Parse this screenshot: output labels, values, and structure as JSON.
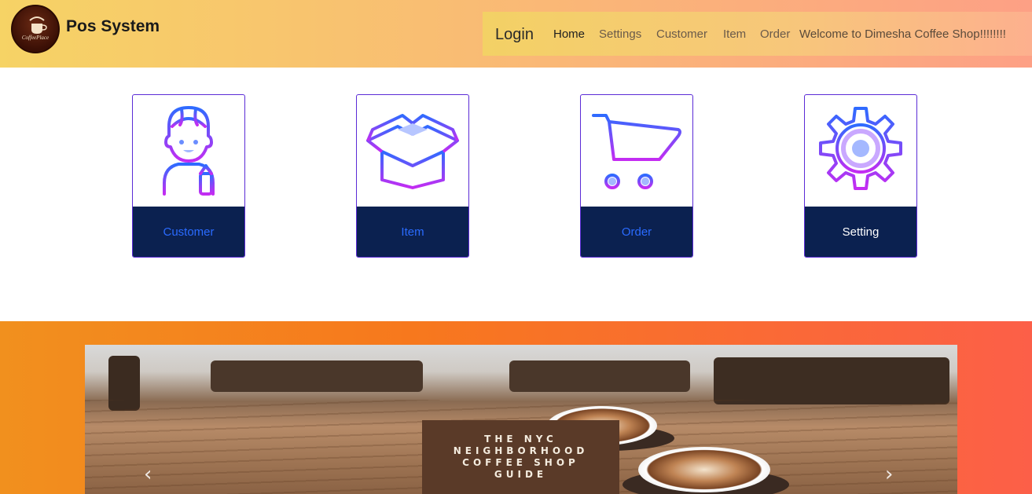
{
  "header": {
    "brand": "Pos System",
    "logo_text": "CoffeePlace",
    "nav": {
      "login": "Login",
      "links": [
        "Home",
        "Settings",
        "Customer",
        "Item",
        "Order"
      ],
      "welcome": "Welcome to Dimesha Coffee Shop!!!!!!!!"
    }
  },
  "cards": [
    {
      "label": "Customer",
      "icon": "customer-icon"
    },
    {
      "label": "Item",
      "icon": "box-icon"
    },
    {
      "label": "Order",
      "icon": "cart-icon"
    },
    {
      "label": "Setting",
      "icon": "gear-icon"
    }
  ],
  "carousel": {
    "poster_lines": [
      "THE NYC",
      "NEIGHBORHOOD",
      "COFFEE SHOP",
      "GUIDE"
    ],
    "prev": "‹",
    "next": "›"
  },
  "colors": {
    "card_footer": "#0b2150",
    "card_label": "#2a6bff",
    "icon_start": "#2f6bff",
    "icon_end": "#c42cf2"
  }
}
